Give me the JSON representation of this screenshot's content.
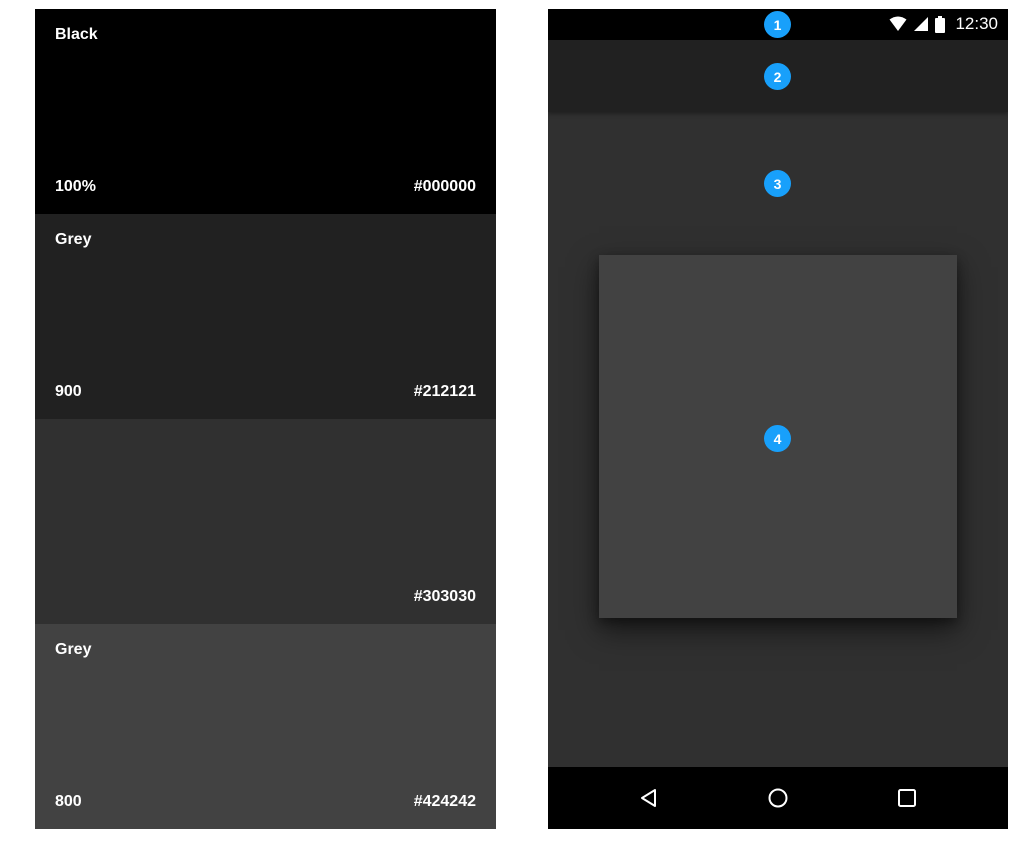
{
  "swatches": [
    {
      "name": "Black",
      "shade": "100%",
      "hex": "#000000",
      "color": "#000000"
    },
    {
      "name": "Grey",
      "shade": "900",
      "hex": "#212121",
      "color": "#212121"
    },
    {
      "name": "",
      "shade": "",
      "hex": "#303030",
      "color": "#303030"
    },
    {
      "name": "Grey",
      "shade": "800",
      "hex": "#424242",
      "color": "#424242"
    }
  ],
  "phone": {
    "status_time": "12:30",
    "icons": [
      "wifi-icon",
      "cell-signal-icon",
      "battery-icon"
    ],
    "markers": [
      "1",
      "2",
      "3",
      "4"
    ],
    "nav": [
      "back-icon",
      "home-icon",
      "recents-icon"
    ]
  },
  "colors": {
    "status_bar": "#000000",
    "app_bar": "#212121",
    "background": "#303030",
    "card": "#424242",
    "marker": "#18a0fb"
  }
}
